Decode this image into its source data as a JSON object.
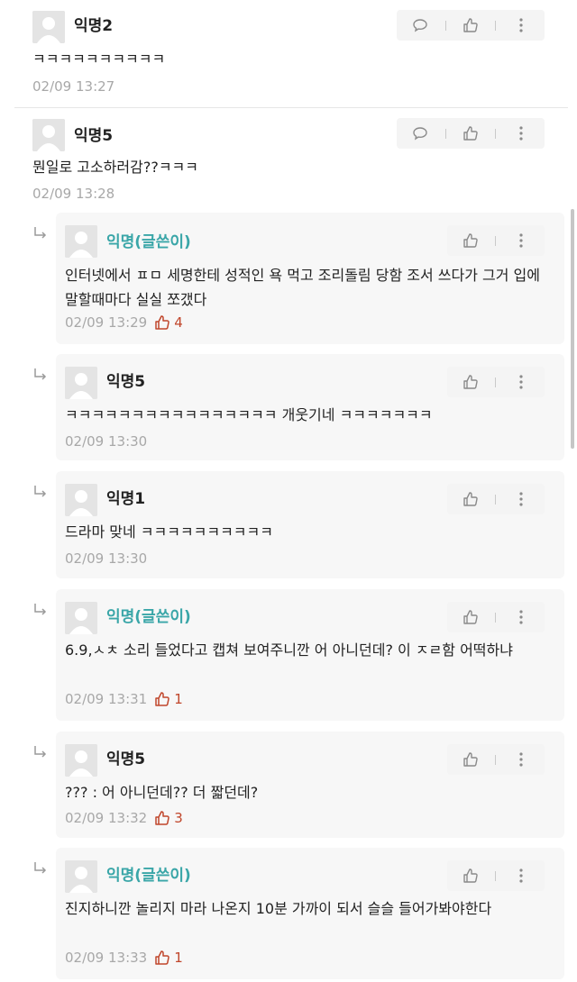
{
  "icons": {
    "comment": "speech-bubble-icon",
    "like": "thumbs-up-icon",
    "more": "vertical-dots-icon",
    "reply": "reply-arrow-icon",
    "avatar": "default-avatar-icon"
  },
  "colors": {
    "author_nick": "#3aa6a8",
    "like_count": "#c0462b",
    "timestamp": "#a8a8a8",
    "reply_bg": "#f7f7f7"
  },
  "comments": [
    {
      "nick": "익명2",
      "text": "ㅋㅋㅋㅋㅋㅋㅋㅋㅋㅋ",
      "time": "02/09 13:27"
    },
    {
      "nick": "익명5",
      "text": "뭔일로 고소하러감??ㅋㅋㅋ",
      "time": "02/09 13:28"
    }
  ],
  "replies": [
    {
      "nick": "익명(글쓴이)",
      "text": "인터넷에서 ㅍㅁ 세명한테 성적인 욕 먹고 조리돌림 당함 조서 쓰다가 그거 입에 말할때마다 실실 쪼갰다",
      "time": "02/09 13:29",
      "likes": "4"
    },
    {
      "nick": "익명5",
      "text": "ㅋㅋㅋㅋㅋㅋㅋㅋㅋㅋㅋㅋㅋㅋㅋㅋ 개웃기네 ㅋㅋㅋㅋㅋㅋㅋ",
      "time": "02/09 13:30",
      "likes": ""
    },
    {
      "nick": "익명1",
      "text": "드라마 맞네 ㅋㅋㅋㅋㅋㅋㅋㅋㅋㅋ",
      "time": "02/09 13:30",
      "likes": ""
    },
    {
      "nick": "익명(글쓴이)",
      "text": "6.9,ㅅㅊ 소리 들었다고 캡쳐 보여주니깐 어 아니던데? 이 ㅈㄹ함 어떡하냐",
      "time": "02/09 13:31",
      "likes": "1"
    },
    {
      "nick": "익명5",
      "text": "??? : 어 아니던데?? 더 짧던데?",
      "time": "02/09 13:32",
      "likes": "3"
    },
    {
      "nick": "익명(글쓴이)",
      "text": "진지하니깐 놀리지 마라 나온지 10분 가까이 되서 슬슬 들어가봐야한다",
      "time": "02/09 13:33",
      "likes": "1"
    }
  ]
}
